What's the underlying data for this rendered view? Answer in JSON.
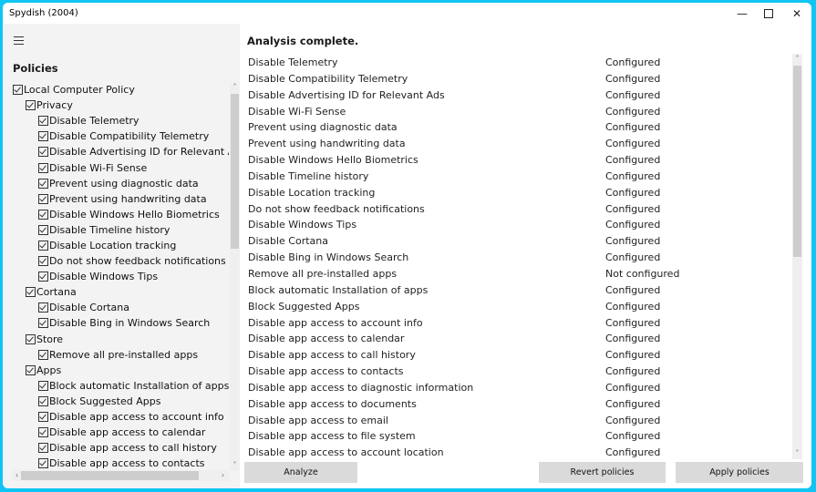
{
  "window": {
    "title": "Spydish (2004)",
    "controls": {
      "minimize": "—",
      "maximize": "",
      "close": "✕"
    },
    "accent_border_color": "#10c4f4"
  },
  "sidebar": {
    "menu_icon": "hamburger-icon",
    "heading": "Policies",
    "tree": [
      {
        "level": 0,
        "label": "Local Computer Policy",
        "checked": true
      },
      {
        "level": 1,
        "label": "Privacy",
        "checked": true
      },
      {
        "level": 2,
        "label": "Disable Telemetry",
        "checked": true
      },
      {
        "level": 2,
        "label": "Disable Compatibility Telemetry",
        "checked": true
      },
      {
        "level": 2,
        "label": "Disable Advertising ID for Relevant Ads",
        "checked": true
      },
      {
        "level": 2,
        "label": "Disable Wi-Fi Sense",
        "checked": true
      },
      {
        "level": 2,
        "label": "Prevent using diagnostic data",
        "checked": true
      },
      {
        "level": 2,
        "label": "Prevent using handwriting data",
        "checked": true
      },
      {
        "level": 2,
        "label": "Disable Windows Hello Biometrics",
        "checked": true
      },
      {
        "level": 2,
        "label": "Disable Timeline history",
        "checked": true
      },
      {
        "level": 2,
        "label": "Disable Location tracking",
        "checked": true
      },
      {
        "level": 2,
        "label": "Do not show feedback notifications",
        "checked": true
      },
      {
        "level": 2,
        "label": "Disable Windows Tips",
        "checked": true
      },
      {
        "level": 1,
        "label": "Cortana",
        "checked": true
      },
      {
        "level": 2,
        "label": "Disable Cortana",
        "checked": true
      },
      {
        "level": 2,
        "label": "Disable Bing in Windows Search",
        "checked": true
      },
      {
        "level": 1,
        "label": "Store",
        "checked": true
      },
      {
        "level": 2,
        "label": "Remove all pre-installed apps",
        "checked": true
      },
      {
        "level": 1,
        "label": "Apps",
        "checked": true
      },
      {
        "level": 2,
        "label": "Block automatic Installation of apps",
        "checked": true
      },
      {
        "level": 2,
        "label": "Block Suggested Apps",
        "checked": true
      },
      {
        "level": 2,
        "label": "Disable app access to account info",
        "checked": true
      },
      {
        "level": 2,
        "label": "Disable app access to calendar",
        "checked": true
      },
      {
        "level": 2,
        "label": "Disable app access to call history",
        "checked": true
      },
      {
        "level": 2,
        "label": "Disable app access to contacts",
        "checked": true
      }
    ],
    "scroll_arrows": {
      "up": "˄",
      "down": "˅",
      "left": "‹",
      "right": "›"
    }
  },
  "main": {
    "status": "Analysis complete.",
    "results": [
      {
        "name": "Disable Telemetry",
        "state": "Configured"
      },
      {
        "name": "Disable Compatibility Telemetry",
        "state": "Configured"
      },
      {
        "name": "Disable Advertising ID for Relevant Ads",
        "state": "Configured"
      },
      {
        "name": "Disable Wi-Fi Sense",
        "state": "Configured"
      },
      {
        "name": "Prevent using diagnostic data",
        "state": "Configured"
      },
      {
        "name": "Prevent using handwriting data",
        "state": "Configured"
      },
      {
        "name": "Disable Windows Hello Biometrics",
        "state": "Configured"
      },
      {
        "name": "Disable Timeline history",
        "state": "Configured"
      },
      {
        "name": "Disable Location tracking",
        "state": "Configured"
      },
      {
        "name": "Do not show feedback notifications",
        "state": "Configured"
      },
      {
        "name": "Disable Windows Tips",
        "state": "Configured"
      },
      {
        "name": "Disable Cortana",
        "state": "Configured"
      },
      {
        "name": "Disable Bing in Windows Search",
        "state": "Configured"
      },
      {
        "name": "Remove all pre-installed apps",
        "state": "Not configured"
      },
      {
        "name": "Block automatic Installation of apps",
        "state": "Configured"
      },
      {
        "name": "Block Suggested Apps",
        "state": "Configured"
      },
      {
        "name": "Disable app access to account info",
        "state": "Configured"
      },
      {
        "name": "Disable app access to calendar",
        "state": "Configured"
      },
      {
        "name": "Disable app access to call history",
        "state": "Configured"
      },
      {
        "name": "Disable app access to contacts",
        "state": "Configured"
      },
      {
        "name": "Disable app access to diagnostic information",
        "state": "Configured"
      },
      {
        "name": "Disable app access to documents",
        "state": "Configured"
      },
      {
        "name": "Disable app access to email",
        "state": "Configured"
      },
      {
        "name": "Disable app access to file system",
        "state": "Configured"
      },
      {
        "name": "Disable app access to account location",
        "state": "Configured"
      }
    ],
    "scroll_arrows": {
      "up": "˄",
      "down": "˅"
    }
  },
  "buttons": {
    "analyze": "Analyze",
    "revert": "Revert policies",
    "apply": "Apply policies"
  }
}
